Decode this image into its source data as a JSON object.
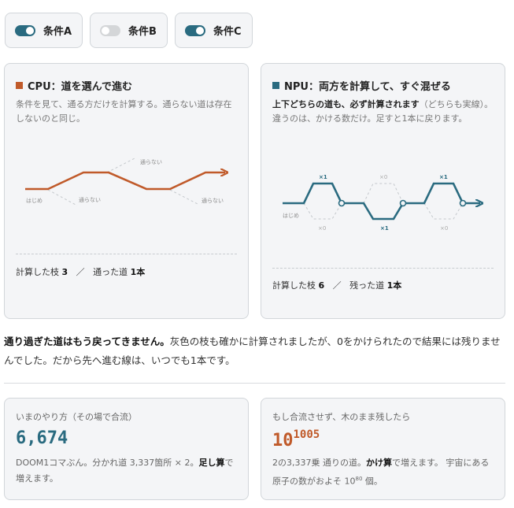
{
  "toggles": [
    {
      "label": "条件A",
      "on": true
    },
    {
      "label": "条件B",
      "on": false
    },
    {
      "label": "条件C",
      "on": true
    }
  ],
  "cpu": {
    "title": "CPU：道を選んで進む",
    "desc": "条件を見て、通る方だけを計算する。通らない道は存在しないのと同じ。",
    "diagram": {
      "start": "はじめ",
      "skip": "通らない"
    },
    "stats": {
      "computed_label": "計算した枝",
      "computed": "3",
      "sep": "／",
      "passed_label": "通った道",
      "passed": "1本"
    }
  },
  "npu": {
    "title": "NPU：両方を計算して、すぐ混ぜる",
    "desc_bold": "上下どちらの道も、必ず計算されます",
    "desc_rest": "（どちらも実線）。違うのは、かける数だけ。足すと1本に戻ります。",
    "diagram": {
      "start": "はじめ",
      "x1": "×1",
      "x0": "×0"
    },
    "stats": {
      "computed_label": "計算した枝",
      "computed": "6",
      "sep": "／",
      "passed_label": "残った道",
      "passed": "1本"
    }
  },
  "note": {
    "bold": "通り過ぎた道はもう戻ってきません。",
    "rest": "灰色の枝も確かに計算されましたが、0をかけられたので結果には残りませんでした。だから先へ進む線は、いつでも1本です。"
  },
  "now": {
    "label": "いまのやり方（その場で合流）",
    "value": "6,674",
    "desc_pre": "DOOM1コマぶん。分かれ道 3,337箇所 × 2。",
    "desc_bold": "足し算",
    "desc_post": "で増えます。"
  },
  "tree": {
    "label": "もし合流させず、木のまま残したら",
    "base": "10",
    "exp": "1005",
    "desc_pre": "2の3,337乗 通りの道。",
    "desc_bold": "かけ算",
    "desc_mid": "で増えます。 宇宙にある原子の数がおよそ ",
    "atoms_base": "10",
    "atoms_exp": "80",
    "desc_post": " 個。"
  },
  "colors": {
    "cpu": "#c05a2a",
    "npu": "#2a6b80",
    "gray": "#c4c8cc"
  }
}
